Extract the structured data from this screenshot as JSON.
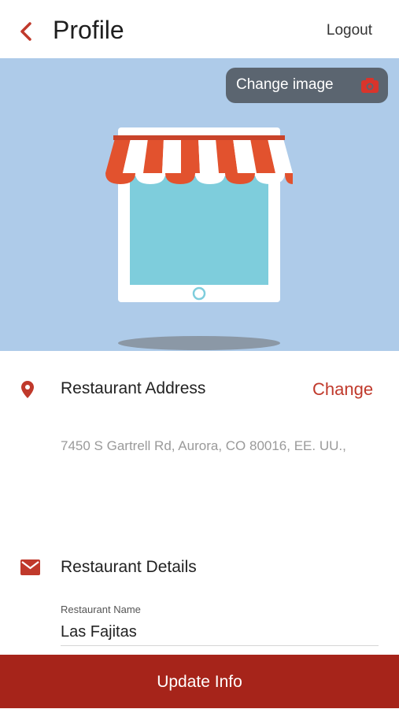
{
  "header": {
    "title": "Profile",
    "logout_label": "Logout",
    "back_icon": "chevron-left-icon"
  },
  "hero": {
    "change_image_label": "Change image",
    "camera_icon": "camera-icon",
    "illustration": "store-icon"
  },
  "address": {
    "icon": "location-pin-icon",
    "title": "Restaurant Address",
    "change_label": "Change",
    "value": "7450 S Gartrell Rd, Aurora, CO 80016, EE. UU.,"
  },
  "details": {
    "icon": "mail-icon",
    "title": "Restaurant Details",
    "name_label": "Restaurant Name",
    "name_value": "Las Fajitas"
  },
  "footer": {
    "update_label": "Update Info"
  },
  "colors": {
    "accent": "#c0392b",
    "button_bg": "#a6241a",
    "hero_bg": "#aecbe9",
    "pill_bg": "#5b6570",
    "awning_red": "#e2522e",
    "screen_blue": "#7ecddc"
  }
}
